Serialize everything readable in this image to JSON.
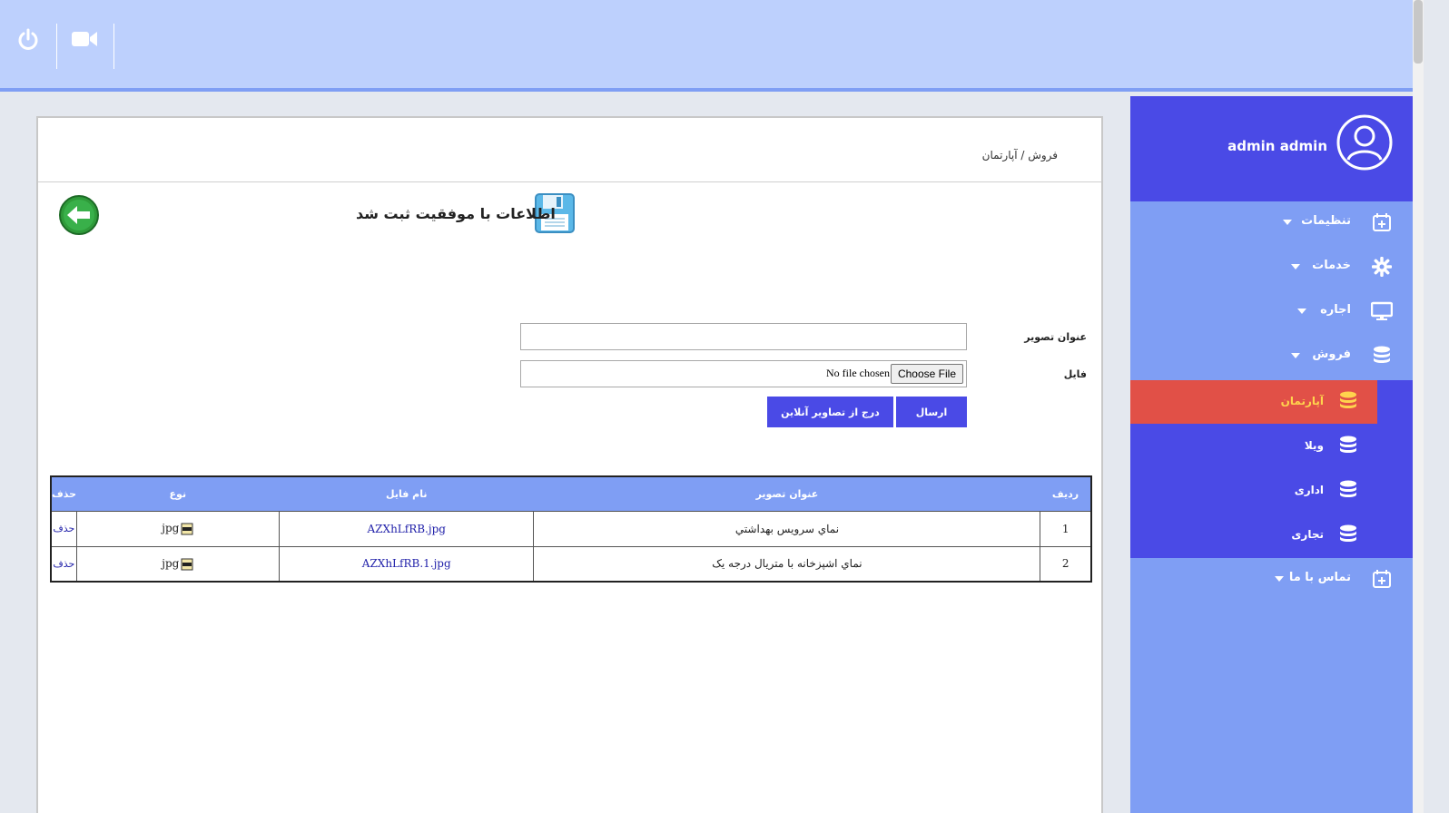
{
  "topbar": {
    "icons": [
      "power-icon",
      "video-camera-icon"
    ]
  },
  "sidebar": {
    "user": {
      "name": "admin admin",
      "icon": "user-avatar-icon"
    },
    "items": [
      {
        "label": "تنظیمات",
        "icon": "calendar-plus-icon"
      },
      {
        "label": "خدمات",
        "icon": "gear-icon"
      },
      {
        "label": "اجاره",
        "icon": "monitor-icon"
      },
      {
        "label": "فروش",
        "icon": "database-icon"
      },
      {
        "label": "تماس با ما",
        "icon": "calendar-plus-icon"
      }
    ],
    "submenu": [
      {
        "label": "آپارتمان",
        "icon": "database-icon",
        "active": true
      },
      {
        "label": "ویلا",
        "icon": "database-icon"
      },
      {
        "label": "اداری",
        "icon": "database-icon"
      },
      {
        "label": "تجاری",
        "icon": "database-icon"
      }
    ]
  },
  "panel": {
    "breadcrumb": "فروش / آپارتمان",
    "success_message": "اطلاعات با موفقیت ثبت شد",
    "form": {
      "title_label": "عنوان تصویر",
      "title_value": "",
      "file_label": "فایل",
      "file_button": "Choose File",
      "file_status": "No file chosen",
      "submit_button": "ارسال",
      "online_button": "درج از تصاویر آنلاین"
    },
    "table": {
      "headers": {
        "row": "ردیف",
        "title": "عنوان تصویر",
        "filename": "نام فایل",
        "type": "نوع",
        "delete": "حذف"
      },
      "rows": [
        {
          "row": "1",
          "title": "نماي سرويس بهداشتي",
          "filename": "AZXhLfRB.jpg",
          "type": "jpg",
          "delete": "حذف"
        },
        {
          "row": "2",
          "title": "نماي اشپزخانه با متريال درجه يک",
          "filename": "AZXhLfRB.1.jpg",
          "type": "jpg",
          "delete": "حذف"
        }
      ]
    }
  },
  "colors": {
    "topbar": "#bdd0fd",
    "sidebar": "#7f9ef4",
    "primary": "#4a4ae6",
    "active": "#e15047",
    "active_text": "#ffd34d"
  }
}
